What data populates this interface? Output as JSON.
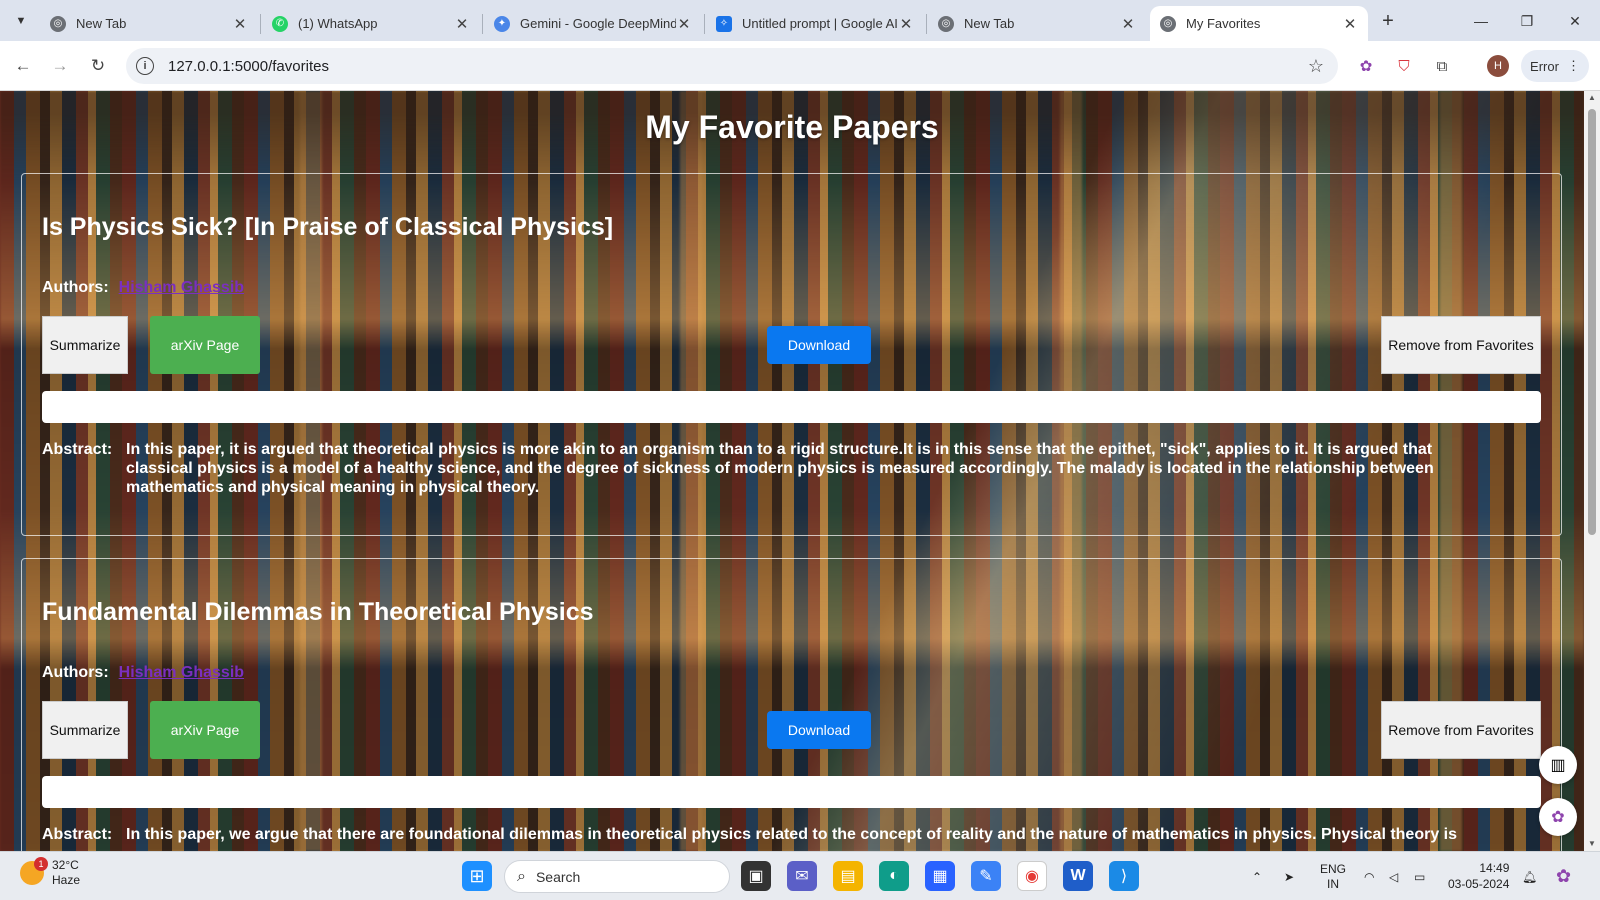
{
  "browser": {
    "tabs": [
      {
        "title": "New Tab",
        "active": false
      },
      {
        "title": "(1) WhatsApp",
        "active": false
      },
      {
        "title": "Gemini - Google DeepMind",
        "active": false
      },
      {
        "title": "Untitled prompt | Google AI",
        "active": false
      },
      {
        "title": "New Tab",
        "active": false
      },
      {
        "title": "My Favorites",
        "active": true
      }
    ],
    "url": "127.0.0.1:5000/favorites",
    "profile_initial": "H",
    "error_label": "Error"
  },
  "page": {
    "title": "My Favorite Papers",
    "authors_label": "Authors:",
    "abstract_label": "Abstract:",
    "buttons": {
      "summarize": "Summarize",
      "arxiv": "arXiv Page",
      "download": "Download",
      "remove": "Remove from Favorites"
    },
    "papers": [
      {
        "title": "Is Physics Sick? [In Praise of Classical Physics]",
        "author": "Hisham Ghassib",
        "abstract": "In this paper, it is argued that theoretical physics is more akin to an organism than to a rigid structure.It is in this sense that the epithet, \"sick\", applies to it. It is argued that classical physics is a model of a healthy science, and the degree of sickness of modern physics is measured accordingly. The malady is located in the relationship between mathematics and physical meaning in physical theory."
      },
      {
        "title": "Fundamental Dilemmas in Theoretical Physics",
        "author": "Hisham Ghassib",
        "abstract": "In this paper, we argue that there are foundational dilemmas in theoretical physics related to the concept of reality and the nature of mathematics in physics. Physical theory is"
      }
    ]
  },
  "taskbar": {
    "weather_temp": "32°C",
    "weather_desc": "Haze",
    "weather_badge": "1",
    "search_label": "Search",
    "lang_top": "ENG",
    "lang_bottom": "IN",
    "time": "14:49",
    "date": "03-05-2024"
  },
  "colors": {
    "download_blue": "#0a78f0",
    "arxiv_green": "#4caf50",
    "author_link": "#7b2fbf"
  }
}
